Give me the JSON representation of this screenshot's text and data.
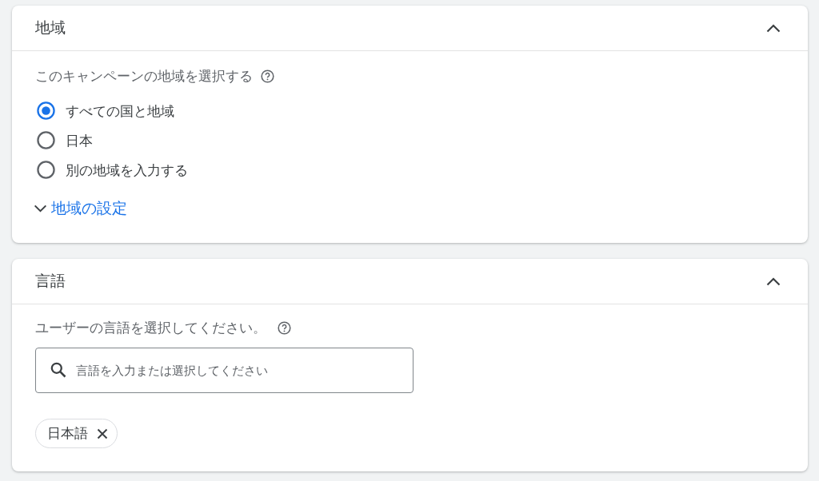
{
  "location_panel": {
    "title": "地域",
    "expanded": true,
    "hint": "このキャンペーンの地域を選択する",
    "options": [
      {
        "label": "すべての国と地域",
        "selected": true
      },
      {
        "label": "日本",
        "selected": false
      },
      {
        "label": "別の地域を入力する",
        "selected": false
      }
    ],
    "settings_link": {
      "label": "地域の設定",
      "expanded": false
    }
  },
  "language_panel": {
    "title": "言語",
    "expanded": true,
    "hint": "ユーザーの言語を選択してください。",
    "search": {
      "placeholder": "言語を入力または選択してください"
    },
    "chips": [
      {
        "label": "日本語"
      }
    ]
  }
}
